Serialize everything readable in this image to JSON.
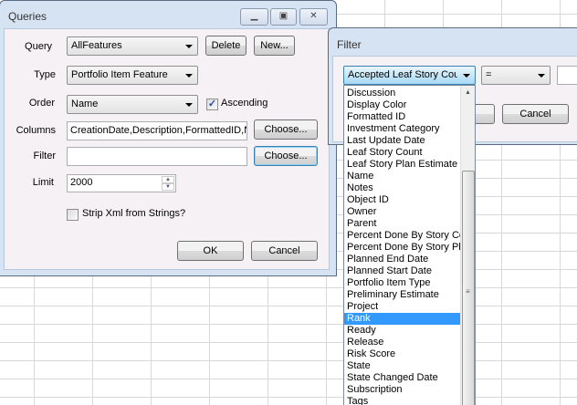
{
  "queries": {
    "title": "Queries",
    "query_label": "Query",
    "query_value": "AllFeatures",
    "delete": "Delete",
    "new": "New...",
    "type_label": "Type",
    "type_value": "Portfolio Item Feature",
    "order_label": "Order",
    "order_value": "Name",
    "ascending": "Ascending",
    "ascending_checked": true,
    "columns_label": "Columns",
    "columns_value": "CreationDate,Description,FormattedID,N...",
    "choose": "Choose...",
    "filter_label": "Filter",
    "filter_value": "",
    "choose2": "Choose...",
    "limit_label": "Limit",
    "limit_value": "2000",
    "strip_xml": "Strip Xml from Strings?",
    "strip_xml_checked": false,
    "ok": "OK",
    "cancel": "Cancel"
  },
  "filter": {
    "title": "Filter",
    "field_value": "Accepted Leaf Story Count",
    "operator_value": "=",
    "value": "",
    "cancel": "Cancel",
    "options": [
      "Discussion",
      "Display Color",
      "Formatted ID",
      "Investment Category",
      "Last Update Date",
      "Leaf Story Count",
      "Leaf Story Plan Estimate Total",
      "Name",
      "Notes",
      "Object ID",
      "Owner",
      "Parent",
      "Percent Done By Story Count",
      "Percent Done By Story Plan Estimate",
      "Planned End Date",
      "Planned Start Date",
      "Portfolio Item Type",
      "Preliminary Estimate",
      "Project",
      "Rank",
      "Ready",
      "Release",
      "Risk Score",
      "State",
      "State Changed Date",
      "Subscription",
      "Tags"
    ],
    "selected": "Rank"
  }
}
